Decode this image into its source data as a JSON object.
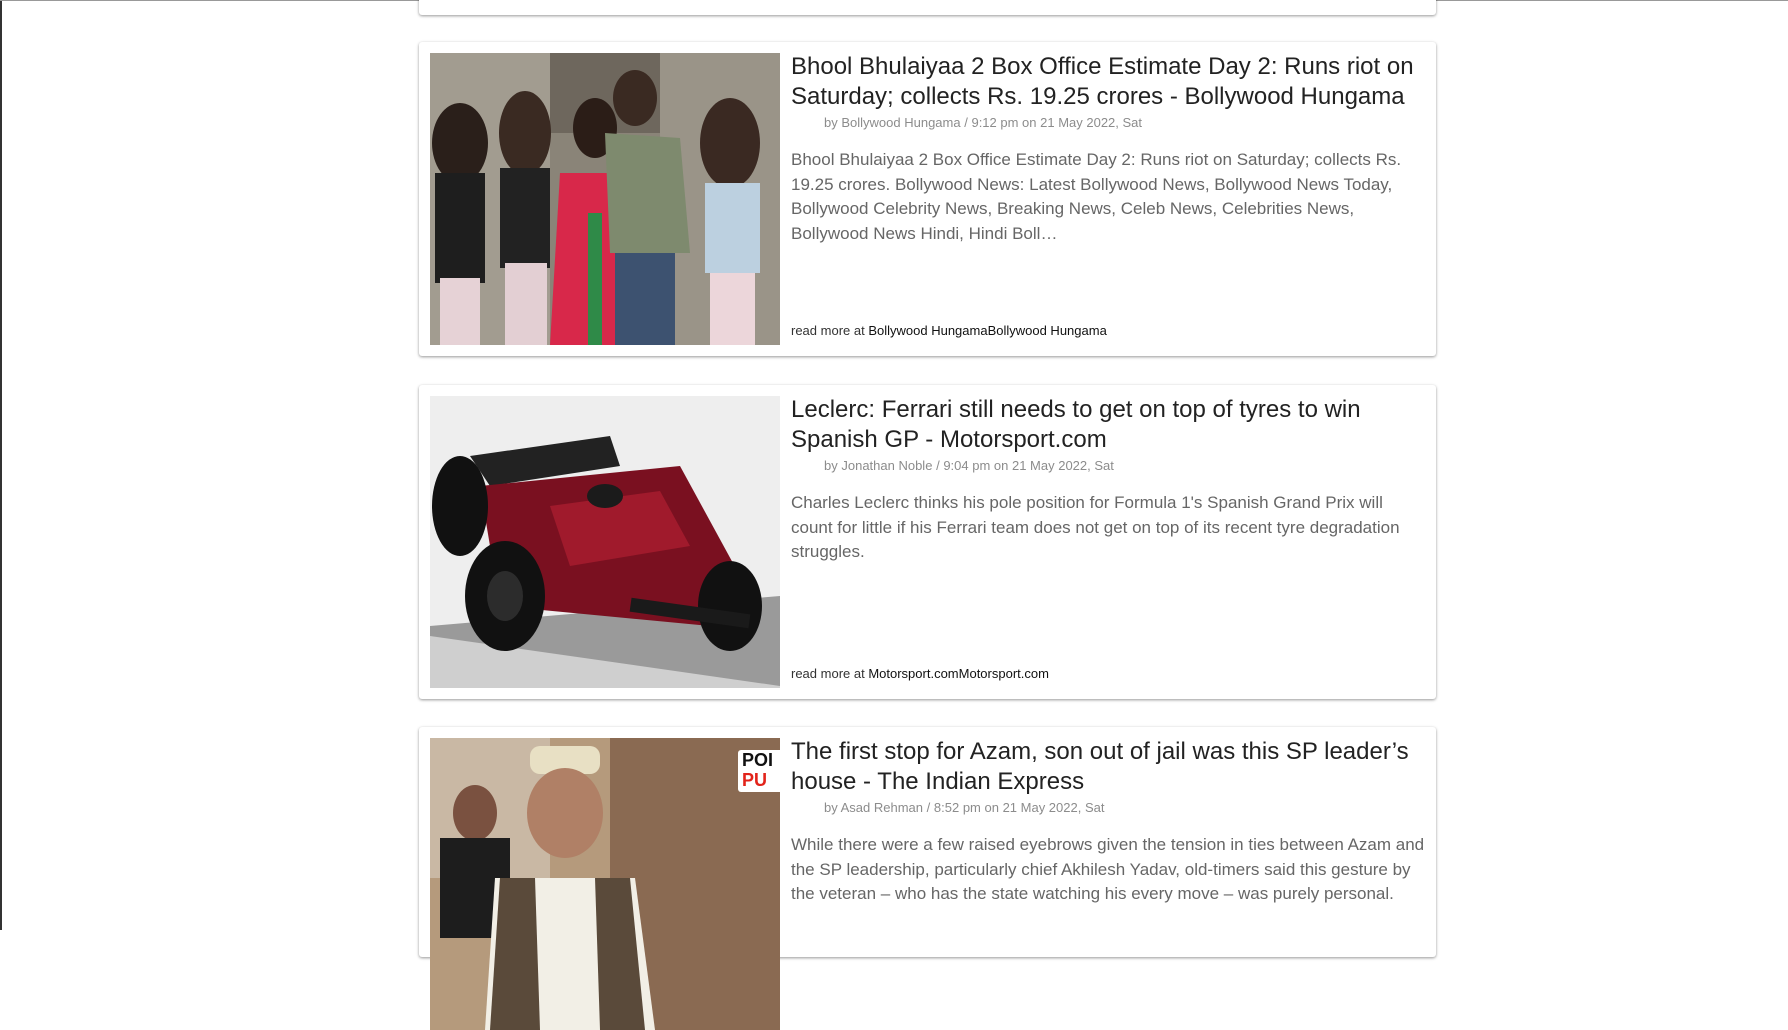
{
  "articles": [
    {
      "title": "Bhool Bhulaiyaa 2 Box Office Estimate Day 2: Runs riot on Saturday; collects Rs. 19.25 crores - Bollywood Hungama",
      "author": "Bollywood Hungama",
      "time": "9:12 pm on 21 May 2022, Sat",
      "summary": "Bhool Bhulaiyaa 2 Box Office Estimate Day 2: Runs riot on Saturday; collects Rs. 19.25 crores. Bollywood News: Latest Bollywood News, Bollywood News Today, Bollywood Celebrity News, Breaking News, Celeb News, Celebrities News, Bollywood News Hindi, Hindi Boll…",
      "read_more_label": "read more at",
      "source": "Bollywood HungamaBollywood Hungama"
    },
    {
      "title": "Leclerc: Ferrari still needs to get on top of tyres to win Spanish GP - Motorsport.com",
      "author": "Jonathan Noble",
      "time": "9:04 pm on 21 May 2022, Sat",
      "summary": "Charles Leclerc thinks his pole position for Formula 1's Spanish Grand Prix will count for little if his Ferrari team does not get on top of its recent tyre degradation struggles.",
      "read_more_label": "read more at",
      "source": "Motorsport.comMotorsport.com"
    },
    {
      "title": "The first stop for Azam, son out of jail was this SP leader’s house - The Indian Express",
      "author": "Asad Rehman",
      "time": "8:52 pm on 21 May 2022, Sat",
      "summary": "While there were a few raised eyebrows given the tension in ties between Azam and the SP leadership, particularly chief Akhilesh Yadav, old-timers said this gesture by the veteran – who has the state watching his every move – was purely personal.",
      "thumb_badge_line1": "POI",
      "thumb_badge_line2": "PU"
    }
  ],
  "labels": {
    "by": "by",
    "separator": "/"
  }
}
